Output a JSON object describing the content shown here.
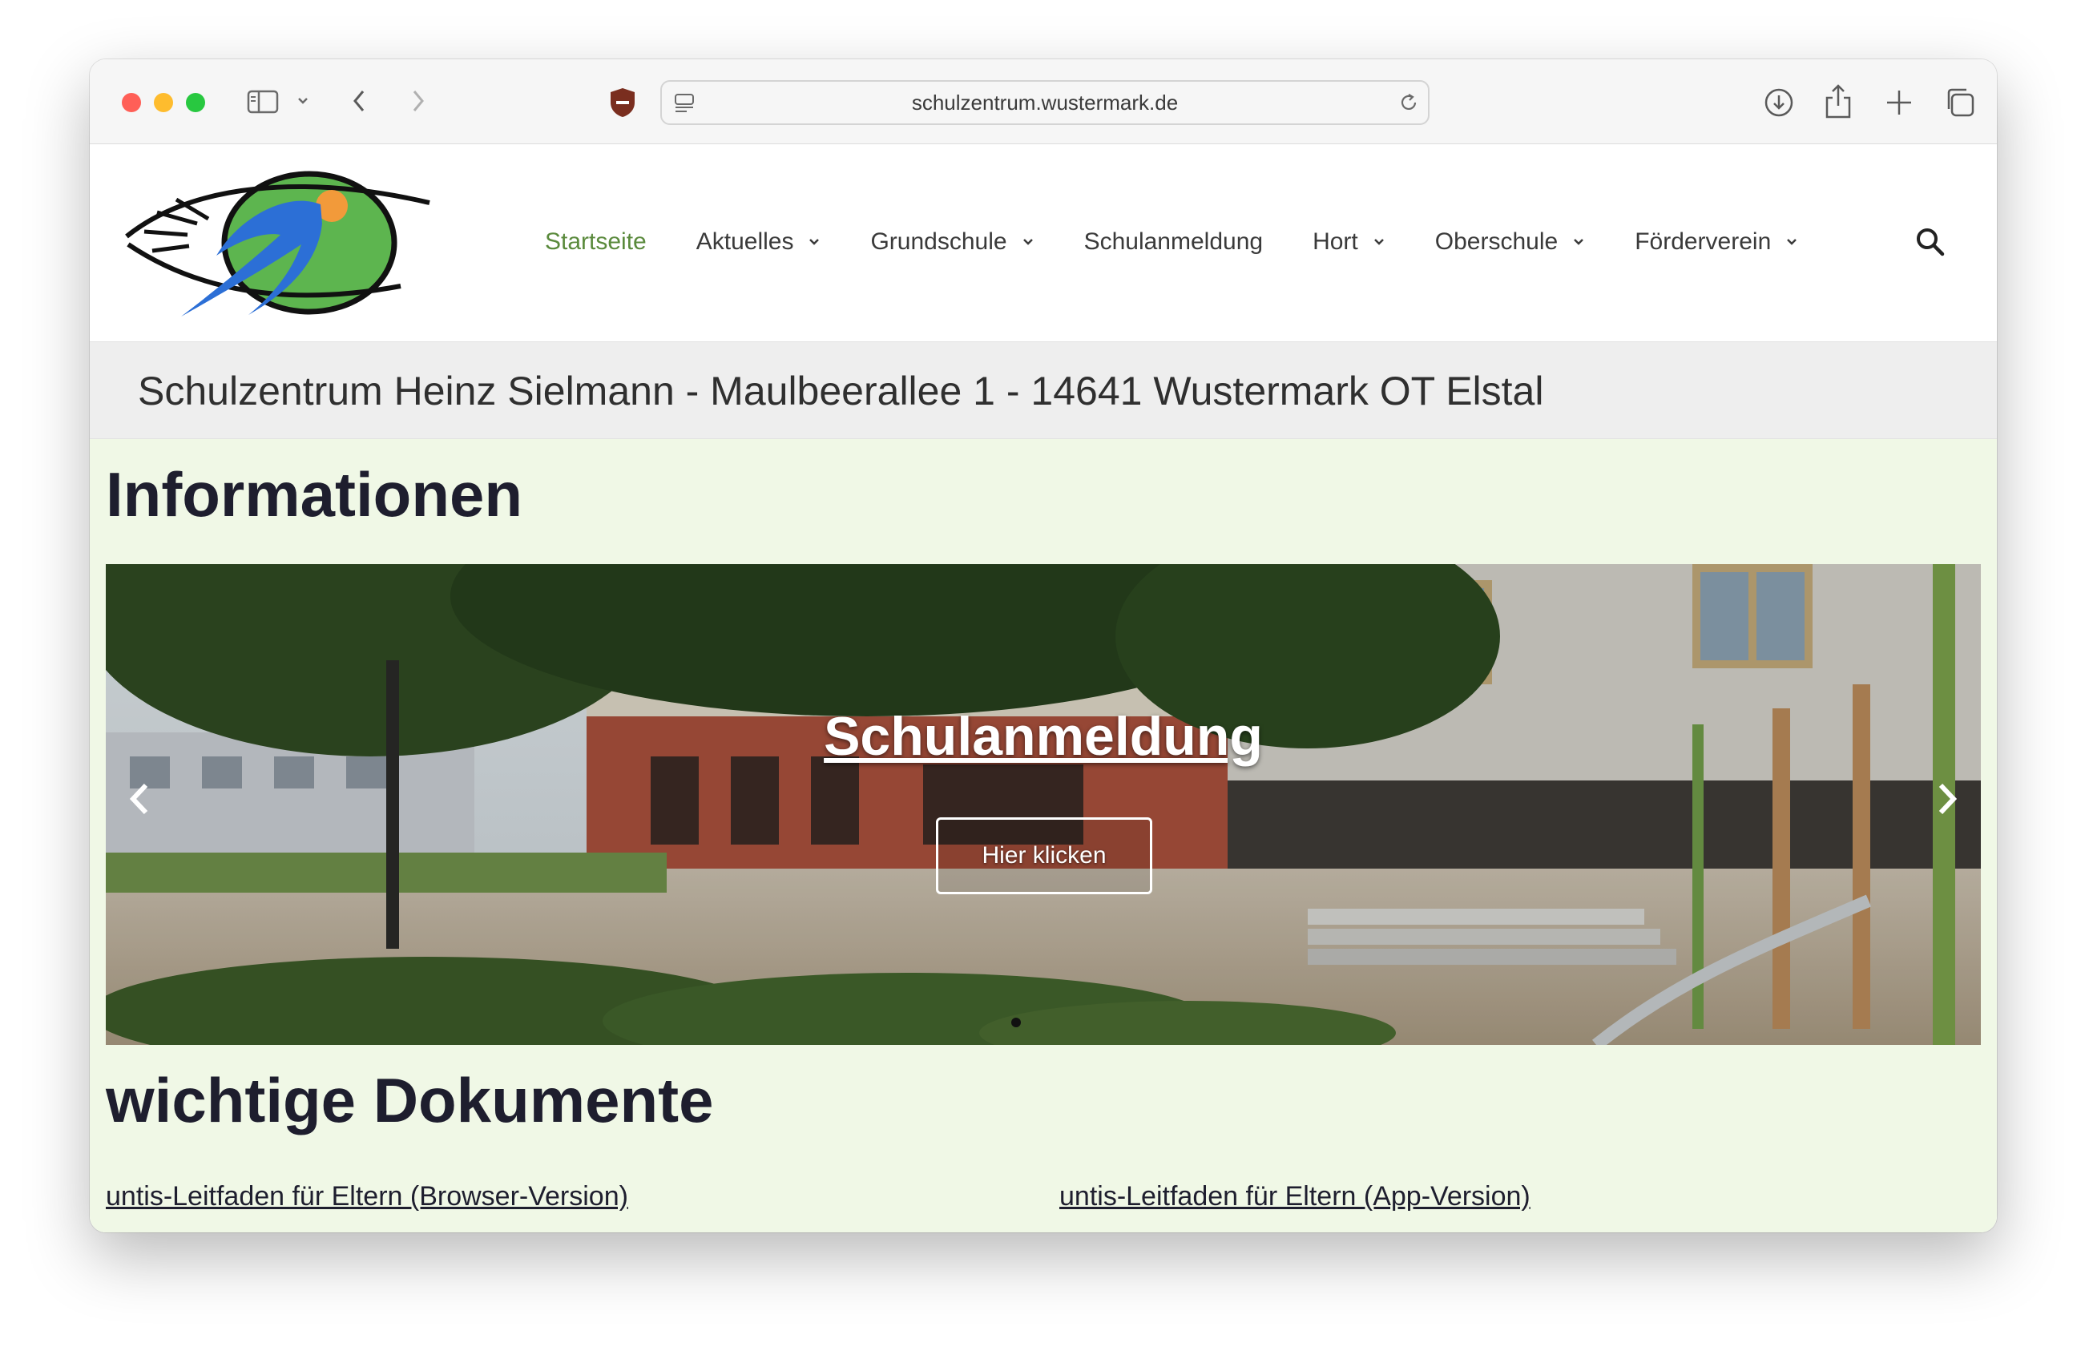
{
  "browser": {
    "url": "schulzentrum.wustermark.de"
  },
  "icons": {
    "sidebar": "sidebar-icon",
    "back": "chevron-left-icon",
    "forward": "chevron-right-icon",
    "shield": "shield-icon",
    "reader": "reader-icon",
    "reload": "reload-icon",
    "download": "download-icon",
    "share": "share-icon",
    "new_tab": "plus-icon",
    "tabs": "tabs-overview-icon",
    "search": "search-icon"
  },
  "nav": {
    "items": [
      {
        "label": "Startseite",
        "active": true,
        "dropdown": false
      },
      {
        "label": "Aktuelles",
        "active": false,
        "dropdown": true
      },
      {
        "label": "Grundschule",
        "active": false,
        "dropdown": true
      },
      {
        "label": "Schulanmeldung",
        "active": false,
        "dropdown": false
      },
      {
        "label": "Hort",
        "active": false,
        "dropdown": true
      },
      {
        "label": "Oberschule",
        "active": false,
        "dropdown": true
      },
      {
        "label": "Förderverein",
        "active": false,
        "dropdown": true
      }
    ]
  },
  "banner": {
    "text": "Schulzentrum Heinz Sielmann - Maulbeerallee 1 - 14641 Wustermark OT Elstal"
  },
  "info": {
    "heading": "Informationen"
  },
  "slider": {
    "title": "Schulanmeldung",
    "button": "Hier klicken"
  },
  "docs": {
    "heading": "wichtige Dokumente",
    "links": [
      "untis-Leitfaden für Eltern (Browser-Version)",
      "untis-Leitfaden für Eltern (App-Version)"
    ]
  },
  "colors": {
    "active_nav": "#5a8a3c",
    "content_bg": "#f0f8e6",
    "banner_bg": "#eeeeee",
    "logo_green": "#5db54f",
    "logo_blue": "#2c6fd6",
    "logo_orange": "#f29a3a"
  }
}
